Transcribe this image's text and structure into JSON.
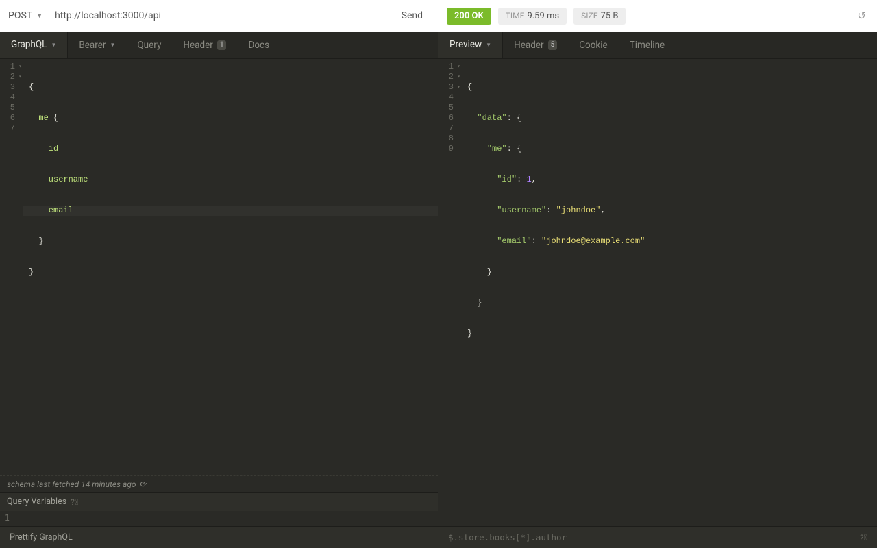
{
  "request": {
    "method": "POST",
    "url": "http://localhost:3000/api",
    "send_label": "Send"
  },
  "response_status": {
    "code": "200 OK",
    "time_label": "TIME",
    "time_value": "9.59 ms",
    "size_label": "SIZE",
    "size_value": "75 B"
  },
  "left_tabs": {
    "graphql": "GraphQL",
    "bearer": "Bearer",
    "query": "Query",
    "header": "Header",
    "header_badge": "1",
    "docs": "Docs"
  },
  "right_tabs": {
    "preview": "Preview",
    "header": "Header",
    "header_badge": "5",
    "cookie": "Cookie",
    "timeline": "Timeline"
  },
  "query_lines": {
    "l1": "{",
    "l2a": "  me ",
    "l2b": "{",
    "l3": "    id",
    "l4": "    username",
    "l5": "    email",
    "l6": "  }",
    "l7": "}"
  },
  "response_lines": {
    "l1": "{",
    "l2_key": "\"data\"",
    "l3_key": "\"me\"",
    "l4_key": "\"id\"",
    "l4_val": "1",
    "l5_key": "\"username\"",
    "l5_val": "\"johndoe\"",
    "l6_key": "\"email\"",
    "l6_val": "\"johndoe@example.com\"",
    "l7": "    }",
    "l8": "  }",
    "l9": "}"
  },
  "schema_status": "schema last fetched 14 minutes ago",
  "query_variables_label": "Query Variables",
  "prettify_label": "Prettify GraphQL",
  "jsonpath_placeholder": "$.store.books[*].author"
}
